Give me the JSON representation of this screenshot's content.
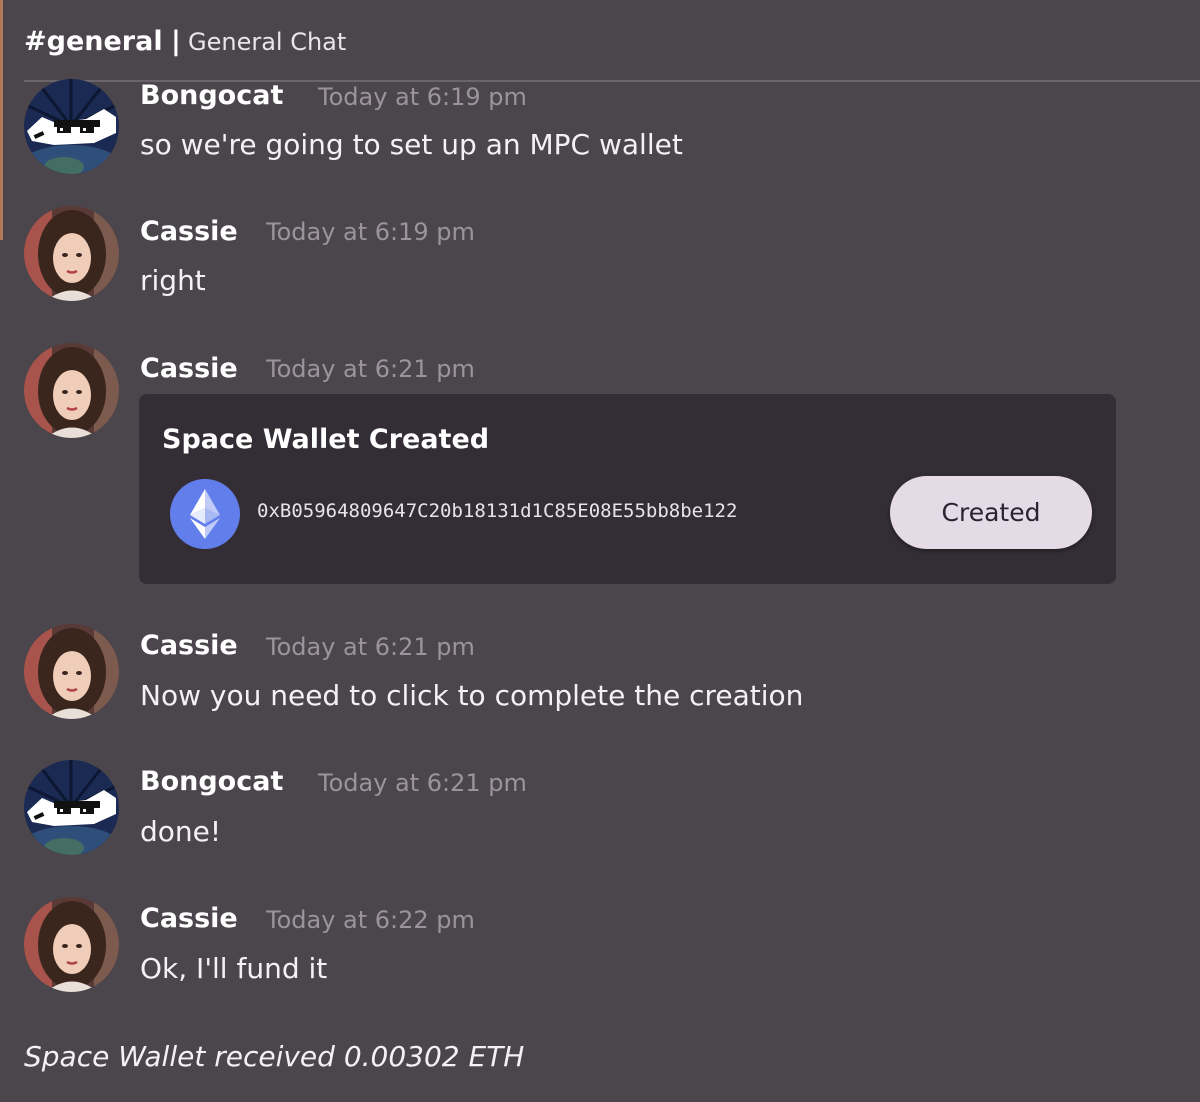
{
  "header": {
    "channel_name": "#general",
    "separator": "|",
    "channel_description": "General Chat"
  },
  "messages": [
    {
      "author": "Bongocat",
      "time": "Today at 6:19 pm",
      "text": "so we're going to set up an MPC wallet",
      "avatar": "bongocat-sunglasses-avatar"
    },
    {
      "author": "Cassie",
      "time": "Today at 6:19 pm",
      "text": "right",
      "avatar": "cassie-photo-avatar"
    },
    {
      "author": "Cassie",
      "time": "Today at 6:21 pm",
      "text": "",
      "avatar": "cassie-photo-avatar"
    },
    {
      "author": "Cassie",
      "time": "Today at 6:21 pm",
      "text": "Now you need to click to complete the creation",
      "avatar": "cassie-photo-avatar"
    },
    {
      "author": "Bongocat",
      "time": "Today at 6:21 pm",
      "text": "done!",
      "avatar": "bongocat-sunglasses-avatar"
    },
    {
      "author": "Cassie",
      "time": "Today at 6:22 pm",
      "text": "Ok, I'll fund it",
      "avatar": "cassie-photo-avatar"
    }
  ],
  "wallet_card": {
    "title": "Space Wallet Created",
    "icon": "ethereum-icon",
    "address": "0xB05964809647C20b18131d1C85E08E55bb8be122",
    "button_label": "Created"
  },
  "system_message": "Space Wallet received 0.00302 ETH",
  "colors": {
    "background": "#4b454c",
    "card_background": "#332d35",
    "button_background": "#e5dbe6",
    "ethereum_blue": "#627eea",
    "timestamp_gray": "#9b949c"
  }
}
